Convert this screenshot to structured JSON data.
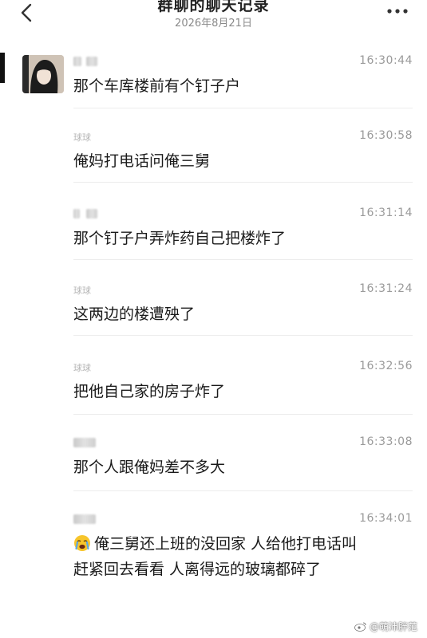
{
  "header": {
    "title": "群聊的聊天记录",
    "date": "2026年8月21日"
  },
  "messages": [
    {
      "sender": "",
      "time": "16:30:44",
      "text": "那个车库楼前有个钉子户"
    },
    {
      "sender": "球球",
      "time": "16:30:58",
      "text": "俺妈打电话问俺三舅"
    },
    {
      "sender": "",
      "time": "16:31:14",
      "text": "那个钉子户弄炸药自己把楼炸了"
    },
    {
      "sender": "球球",
      "time": "16:31:24",
      "text": "这两边的楼遭殃了"
    },
    {
      "sender": "球球",
      "time": "16:32:56",
      "text": "把他自己家的房子炸了"
    },
    {
      "sender": "",
      "time": "16:33:08",
      "text": "那个人跟俺妈差不多大"
    },
    {
      "sender": "",
      "time": "16:34:01",
      "text": "俺三舅还上班的没回家 人给他打电话叫",
      "text_line2": "赶紧回去看看 人离得远的玻璃都碎了"
    }
  ],
  "watermark": "@萌沛胖范"
}
